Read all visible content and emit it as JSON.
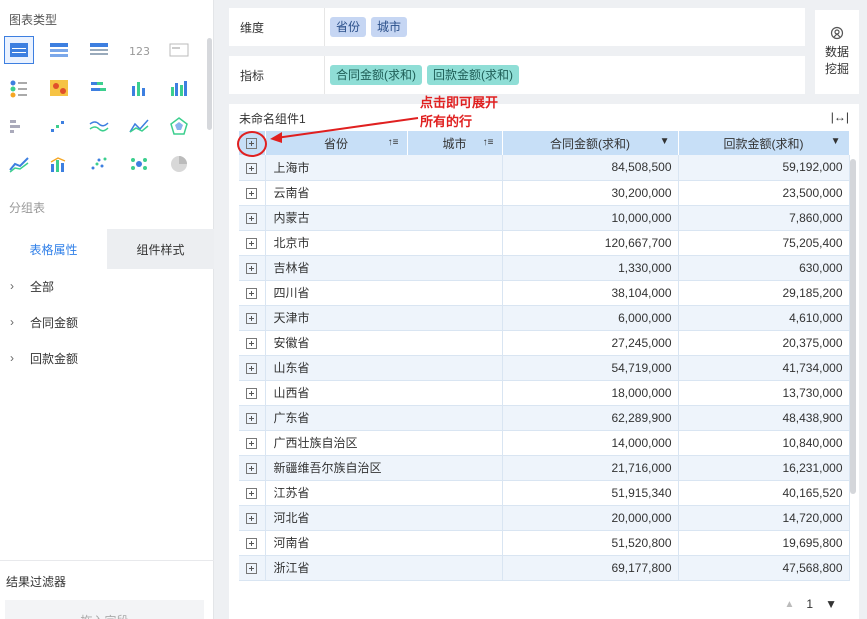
{
  "left_panel": {
    "chart_type_title": "图表类型",
    "group_table_title": "分组表",
    "chart_types": [
      {
        "icon": "group-table-icon",
        "selected": true
      },
      {
        "icon": "cross-table-icon",
        "selected": false
      },
      {
        "icon": "detail-table-icon",
        "selected": false
      },
      {
        "icon": "kpi-number-icon",
        "selected": false
      },
      {
        "icon": "text-card-icon",
        "selected": false
      },
      {
        "icon": "dot-matrix-icon",
        "selected": false
      },
      {
        "icon": "heatmap-icon",
        "selected": false
      },
      {
        "icon": "stacked-bar-icon",
        "selected": false
      },
      {
        "icon": "column-chart-icon",
        "selected": false
      },
      {
        "icon": "grouped-column-icon",
        "selected": false
      },
      {
        "icon": "bar-list-icon",
        "selected": false
      },
      {
        "icon": "scatter-step-icon",
        "selected": false
      },
      {
        "icon": "multi-line-icon",
        "selected": false
      },
      {
        "icon": "area-line-icon",
        "selected": false
      },
      {
        "icon": "radar-icon",
        "selected": false
      },
      {
        "icon": "line-chart-icon",
        "selected": false
      },
      {
        "icon": "combo-chart-icon",
        "selected": false
      },
      {
        "icon": "scatter-icon",
        "selected": false
      },
      {
        "icon": "bubble-cluster-icon",
        "selected": false
      },
      {
        "icon": "pie-chart-icon",
        "selected": false
      }
    ],
    "prop_tabs": [
      "表格属性",
      "组件样式"
    ],
    "tree_items": [
      "全部",
      "合同金额",
      "回款金额"
    ],
    "filter_title": "结果过滤器",
    "filter_placeholder": "拖入字段"
  },
  "dimension": {
    "label": "维度",
    "pills": [
      "省份",
      "城市"
    ]
  },
  "metric": {
    "label": "指标",
    "pills": [
      "合同金额(求和)",
      "回款金额(求和)"
    ]
  },
  "data_mining": {
    "line1": "数据",
    "line2": "挖掘"
  },
  "component": {
    "title": "未命名组件1",
    "columns": [
      "省份",
      "城市",
      "合同金额(求和)",
      "回款金额(求和)"
    ],
    "rows": [
      {
        "province": "上海市",
        "contract": "84,508,500",
        "payment": "59,192,000"
      },
      {
        "province": "云南省",
        "contract": "30,200,000",
        "payment": "23,500,000"
      },
      {
        "province": "内蒙古",
        "contract": "10,000,000",
        "payment": "7,860,000"
      },
      {
        "province": "北京市",
        "contract": "120,667,700",
        "payment": "75,205,400"
      },
      {
        "province": "吉林省",
        "contract": "1,330,000",
        "payment": "630,000"
      },
      {
        "province": "四川省",
        "contract": "38,104,000",
        "payment": "29,185,200"
      },
      {
        "province": "天津市",
        "contract": "6,000,000",
        "payment": "4,610,000"
      },
      {
        "province": "安徽省",
        "contract": "27,245,000",
        "payment": "20,375,000"
      },
      {
        "province": "山东省",
        "contract": "54,719,000",
        "payment": "41,734,000"
      },
      {
        "province": "山西省",
        "contract": "18,000,000",
        "payment": "13,730,000"
      },
      {
        "province": "广东省",
        "contract": "62,289,900",
        "payment": "48,438,900"
      },
      {
        "province": "广西壮族自治区",
        "contract": "14,000,000",
        "payment": "10,840,000"
      },
      {
        "province": "新疆维吾尔族自治区",
        "contract": "21,716,000",
        "payment": "16,231,000"
      },
      {
        "province": "江苏省",
        "contract": "51,915,340",
        "payment": "40,165,520"
      },
      {
        "province": "河北省",
        "contract": "20,000,000",
        "payment": "14,720,000"
      },
      {
        "province": "河南省",
        "contract": "51,520,800",
        "payment": "19,695,800"
      },
      {
        "province": "浙江省",
        "contract": "69,177,800",
        "payment": "47,568,800"
      }
    ],
    "page": "1"
  },
  "annotation": {
    "line1": "点击即可展开",
    "line2": "所有的行",
    "color": "#e02020"
  }
}
